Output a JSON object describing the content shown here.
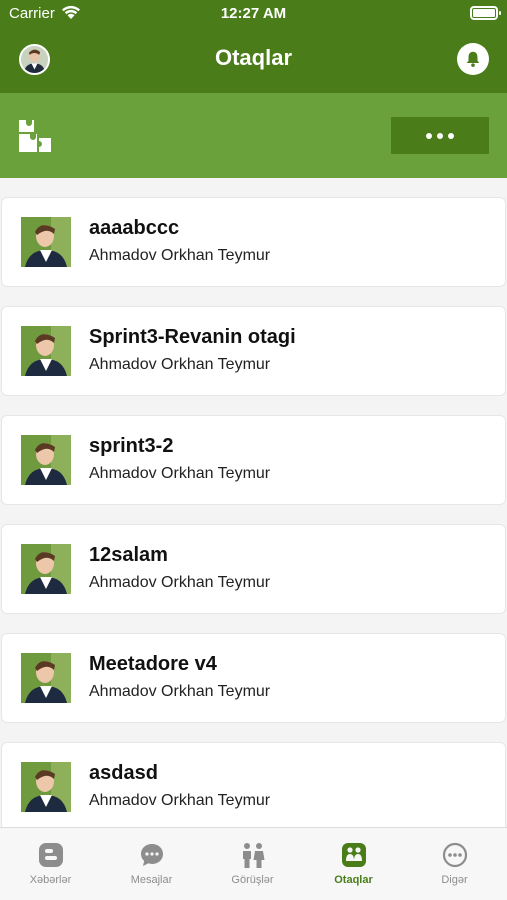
{
  "status_bar": {
    "carrier": "Carrier",
    "time": "12:27 AM"
  },
  "header": {
    "title": "Otaqlar"
  },
  "rooms": [
    {
      "name": "aaaabccc",
      "owner": "Ahmadov Orkhan Teymur"
    },
    {
      "name": "Sprint3-Revanin otagi",
      "owner": "Ahmadov Orkhan Teymur"
    },
    {
      "name": "sprint3-2",
      "owner": "Ahmadov Orkhan Teymur"
    },
    {
      "name": "12salam",
      "owner": "Ahmadov Orkhan Teymur"
    },
    {
      "name": "Meetadore v4",
      "owner": "Ahmadov Orkhan Teymur"
    },
    {
      "name": "asdasd",
      "owner": "Ahmadov Orkhan Teymur"
    }
  ],
  "tabs": [
    {
      "label": "Xəbərlər",
      "icon": "blogger-icon"
    },
    {
      "label": "Mesajlar",
      "icon": "chat-bubble-icon"
    },
    {
      "label": "Görüşlər",
      "icon": "people-icon"
    },
    {
      "label": "Otaqlar",
      "icon": "rooms-icon"
    },
    {
      "label": "Digər",
      "icon": "more-circle-icon"
    }
  ],
  "active_tab": "Otaqlar",
  "colors": {
    "header_dark_green": "#4a7d1a",
    "toolbar_light_green": "#6aa13a",
    "tab_inactive": "#8d8d8d"
  }
}
